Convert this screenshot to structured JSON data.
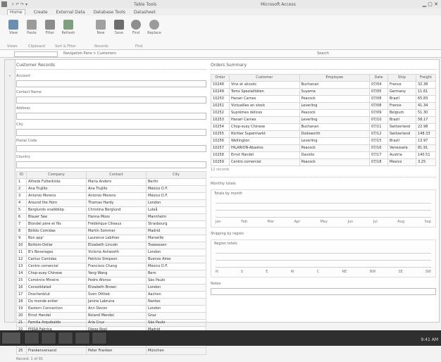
{
  "titlebar": {
    "quick_access": "⚡ ↶ ↷ ▾",
    "tools_label": "Table Tools",
    "window_title": "Microsoft Access",
    "controls": "▁ ▢ ✕"
  },
  "ribbon": {
    "tabs": [
      "Home",
      "Create",
      "External Data",
      "Database Tools",
      "Datasheet"
    ],
    "active_tab": "Home",
    "buttons": [
      {
        "label": "View"
      },
      {
        "label": "Paste"
      },
      {
        "label": "Filter"
      },
      {
        "label": "Refresh"
      },
      {
        "label": "New"
      },
      {
        "label": "Save"
      },
      {
        "label": "Find"
      },
      {
        "label": "Replace"
      }
    ],
    "groups": [
      "Views",
      "Clipboard",
      "Sort & Filter",
      "Records",
      "Find"
    ]
  },
  "formula": {
    "namebox": "",
    "path": "Navigation Pane > Customers",
    "hint": "Search"
  },
  "left_panel": {
    "title": "Customer Records",
    "fields": [
      {
        "label": "Account"
      },
      {
        "label": "Contact Name"
      },
      {
        "label": "Address"
      },
      {
        "label": "City"
      },
      {
        "label": "Postal Code"
      },
      {
        "label": "Country"
      }
    ],
    "table": {
      "headers": [
        "ID",
        "Company",
        "Contact",
        "City"
      ],
      "rows": [
        [
          "1",
          "Alfreds Futterkiste",
          "Maria Anders",
          "Berlin"
        ],
        [
          "2",
          "Ana Trujillo",
          "Ana Trujillo",
          "México D.F."
        ],
        [
          "3",
          "Antonio Moreno",
          "Antonio Moreno",
          "México D.F."
        ],
        [
          "4",
          "Around the Horn",
          "Thomas Hardy",
          "London"
        ],
        [
          "5",
          "Berglunds snabbköp",
          "Christina Berglund",
          "Luleå"
        ],
        [
          "6",
          "Blauer See",
          "Hanna Moos",
          "Mannheim"
        ],
        [
          "7",
          "Blondel père et fils",
          "Frédérique Citeaux",
          "Strasbourg"
        ],
        [
          "8",
          "Bólido Comidas",
          "Martín Sommer",
          "Madrid"
        ],
        [
          "9",
          "Bon app'",
          "Laurence Lebihan",
          "Marseille"
        ],
        [
          "10",
          "Bottom-Dollar",
          "Elizabeth Lincoln",
          "Tsawassen"
        ],
        [
          "11",
          "B's Beverages",
          "Victoria Ashworth",
          "London"
        ],
        [
          "12",
          "Cactus Comidas",
          "Patricio Simpson",
          "Buenos Aires"
        ],
        [
          "13",
          "Centro comercial",
          "Francisco Chang",
          "México D.F."
        ],
        [
          "14",
          "Chop-suey Chinese",
          "Yang Wang",
          "Bern"
        ],
        [
          "15",
          "Comércio Mineiro",
          "Pedro Afonso",
          "São Paulo"
        ],
        [
          "16",
          "Consolidated",
          "Elizabeth Brown",
          "London"
        ],
        [
          "17",
          "Drachenblut",
          "Sven Ottlieb",
          "Aachen"
        ],
        [
          "18",
          "Du monde entier",
          "Janine Labrune",
          "Nantes"
        ],
        [
          "19",
          "Eastern Connection",
          "Ann Devon",
          "London"
        ],
        [
          "20",
          "Ernst Handel",
          "Roland Mendel",
          "Graz"
        ],
        [
          "21",
          "Familia Arquibaldo",
          "Aria Cruz",
          "São Paulo"
        ],
        [
          "22",
          "FISSA Fabrica",
          "Diego Roel",
          "Madrid"
        ],
        [
          "23",
          "Folies gourmandes",
          "Martine Rancé",
          "Lille"
        ],
        [
          "24",
          "Folk och fä HB",
          "Maria Larsson",
          "Bräcke"
        ],
        [
          "25",
          "Frankenversand",
          "Peter Franken",
          "München"
        ]
      ]
    },
    "footer": "Record: 1 of 91"
  },
  "right_panel": {
    "title": "Orders Summary",
    "table": {
      "headers": [
        "Order",
        "Customer",
        "Employee",
        "Date",
        "Ship",
        "Freight"
      ],
      "rows": [
        [
          "10248",
          "Vins et alcools",
          "Buchanan",
          "07/04",
          "France",
          "32.38"
        ],
        [
          "10249",
          "Toms Spezialitäten",
          "Suyama",
          "07/05",
          "Germany",
          "11.61"
        ],
        [
          "10250",
          "Hanari Carnes",
          "Peacock",
          "07/08",
          "Brazil",
          "65.83"
        ],
        [
          "10251",
          "Victuailles en stock",
          "Leverling",
          "07/08",
          "France",
          "41.34"
        ],
        [
          "10252",
          "Suprêmes délices",
          "Peacock",
          "07/09",
          "Belgium",
          "51.30"
        ],
        [
          "10253",
          "Hanari Carnes",
          "Leverling",
          "07/10",
          "Brazil",
          "58.17"
        ],
        [
          "10254",
          "Chop-suey Chinese",
          "Buchanan",
          "07/11",
          "Switzerland",
          "22.98"
        ],
        [
          "10255",
          "Richter Supermarkt",
          "Dodsworth",
          "07/12",
          "Switzerland",
          "148.33"
        ],
        [
          "10256",
          "Wellington",
          "Leverling",
          "07/15",
          "Brazil",
          "13.97"
        ],
        [
          "10257",
          "HILARION-Abastos",
          "Peacock",
          "07/16",
          "Venezuela",
          "81.91"
        ],
        [
          "10258",
          "Ernst Handel",
          "Davolio",
          "07/17",
          "Austria",
          "140.51"
        ],
        [
          "10259",
          "Centro comercial",
          "Peacock",
          "07/18",
          "Mexico",
          "3.25"
        ]
      ],
      "note": "12 records"
    },
    "section2_title": "Monthly totals",
    "chart1": {
      "title": "Totals by month",
      "labels": [
        "Jan",
        "Feb",
        "Mar",
        "Apr",
        "May",
        "Jun",
        "Jul",
        "Aug",
        "Sep"
      ]
    },
    "section3_title": "Shipping by region",
    "chart2": {
      "title": "Region totals",
      "labels": [
        "N",
        "S",
        "E",
        "W",
        "C",
        "NE",
        "NW",
        "SE",
        "SW"
      ]
    },
    "section4_title": "Notes"
  },
  "statusbar": {
    "tray": "9:41 AM"
  }
}
